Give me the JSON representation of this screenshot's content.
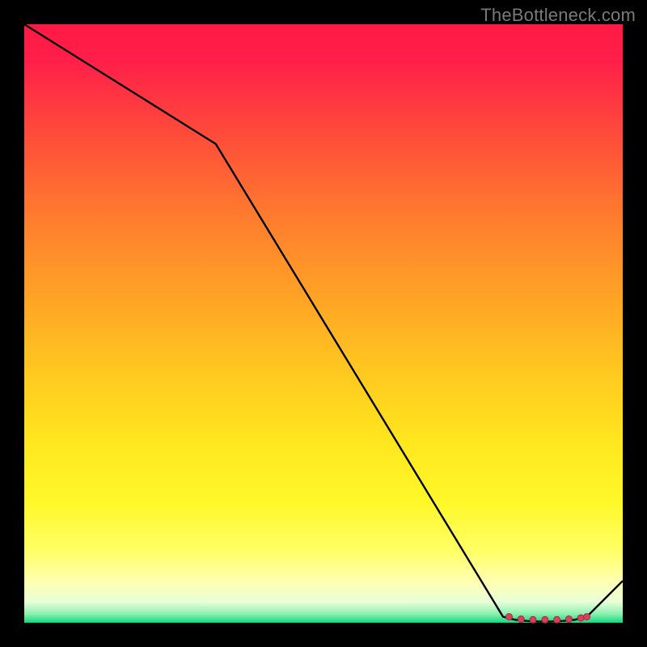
{
  "watermark": "TheBottleneck.com",
  "chart_data": {
    "type": "line",
    "title": "",
    "xlabel": "",
    "ylabel": "",
    "xlim": [
      0,
      100
    ],
    "ylim": [
      0,
      100
    ],
    "x": [
      0,
      32,
      80,
      82,
      84,
      86,
      88,
      90,
      92,
      94,
      100
    ],
    "values": [
      100,
      80,
      1.0,
      0.5,
      0.3,
      0.2,
      0.2,
      0.3,
      0.5,
      1.0,
      7
    ],
    "annotations": [
      {
        "label": "flat-zone-dot-1",
        "x": 81,
        "y": 1.0
      },
      {
        "label": "flat-zone-dot-2",
        "x": 83,
        "y": 0.6
      },
      {
        "label": "flat-zone-dot-3",
        "x": 85,
        "y": 0.5
      },
      {
        "label": "flat-zone-dot-4",
        "x": 87,
        "y": 0.5
      },
      {
        "label": "flat-zone-dot-5",
        "x": 89,
        "y": 0.5
      },
      {
        "label": "flat-zone-dot-6",
        "x": 91,
        "y": 0.6
      },
      {
        "label": "flat-zone-dot-7",
        "x": 93,
        "y": 0.8
      },
      {
        "label": "flat-zone-dot-8",
        "x": 94,
        "y": 1.0
      }
    ]
  },
  "plot_geometry": {
    "leftPx": 30,
    "topPx": 30,
    "widthPx": 740,
    "heightPx": 740
  },
  "gradient_stops": [
    {
      "offset": 0.0,
      "color": "#ff1a45"
    },
    {
      "offset": 0.06,
      "color": "#ff1f4a"
    },
    {
      "offset": 0.18,
      "color": "#ff4a3a"
    },
    {
      "offset": 0.32,
      "color": "#ff7b2e"
    },
    {
      "offset": 0.46,
      "color": "#ffa425"
    },
    {
      "offset": 0.58,
      "color": "#ffc81f"
    },
    {
      "offset": 0.7,
      "color": "#ffe71e"
    },
    {
      "offset": 0.8,
      "color": "#fff82a"
    },
    {
      "offset": 0.88,
      "color": "#ffff66"
    },
    {
      "offset": 0.93,
      "color": "#ffffb0"
    },
    {
      "offset": 0.965,
      "color": "#e9ffd8"
    },
    {
      "offset": 0.985,
      "color": "#8df0b0"
    },
    {
      "offset": 1.0,
      "color": "#0fd97e"
    }
  ],
  "colors": {
    "line": "#000000",
    "dot_fill": "#d9405a",
    "dot_stroke": "#a12d42",
    "background": "#000000"
  }
}
